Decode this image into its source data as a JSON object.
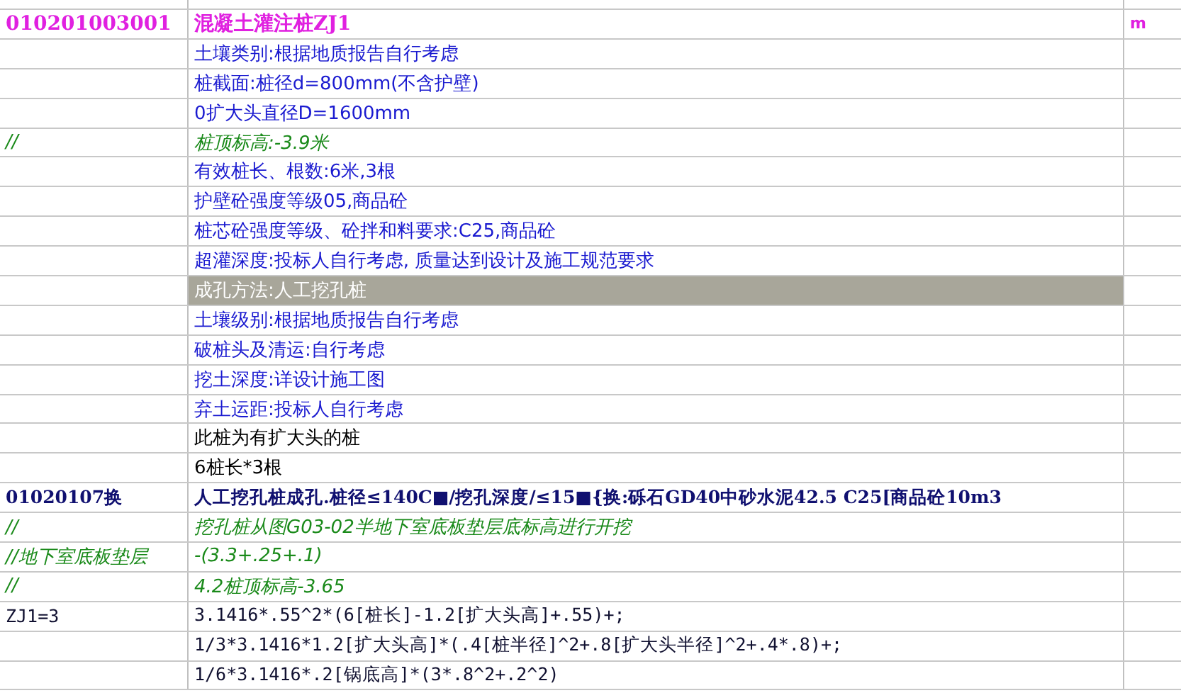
{
  "rows": [
    {
      "kind": "item",
      "code": "010201003001",
      "text": "混凝土灌注桩ZJ1",
      "unit": "m",
      "selected": false
    },
    {
      "kind": "feature",
      "text": "土壤类别:根据地质报告自行考虑",
      "selected": false
    },
    {
      "kind": "feature",
      "text": "桩截面:桩径d=800mm(不含护壁)",
      "selected": false
    },
    {
      "kind": "feature",
      "text": "0扩大头直径D=1600mm",
      "selected": false
    },
    {
      "kind": "comment",
      "code": "//",
      "text": "桩顶标高:-3.9米",
      "selected": false
    },
    {
      "kind": "feature",
      "text": "有效桩长、根数:6米,3根",
      "selected": false
    },
    {
      "kind": "feature",
      "text": "护壁砼强度等级05,商品砼",
      "selected": false
    },
    {
      "kind": "feature",
      "text": "桩芯砼强度等级、砼拌和料要求:C25,商品砼",
      "selected": false
    },
    {
      "kind": "feature",
      "text": "超灌深度:投标人自行考虑, 质量达到设计及施工规范要求",
      "selected": false
    },
    {
      "kind": "feature",
      "text": "成孔方法:人工挖孔桩",
      "selected": true
    },
    {
      "kind": "feature",
      "text": "土壤级别:根据地质报告自行考虑",
      "selected": false
    },
    {
      "kind": "feature",
      "text": "破桩头及清运:自行考虑",
      "selected": false
    },
    {
      "kind": "feature",
      "text": "挖土深度:详设计施工图",
      "selected": false
    },
    {
      "kind": "feature",
      "text": "弃土运距:投标人自行考虑",
      "selected": false
    },
    {
      "kind": "note",
      "text": "此桩为有扩大头的桩",
      "selected": false
    },
    {
      "kind": "note",
      "text": "6桩长*3根",
      "selected": false
    },
    {
      "kind": "sub",
      "code": "01020107换",
      "text": "人工挖孔桩成孔.桩径≤140C■/挖孔深度/≤15■{换:砾石GD40中砂水泥42.5 C25[商品砼10m3",
      "selected": false
    },
    {
      "kind": "comment",
      "code": "//",
      "text": "挖孔桩从图G03-02半地下室底板垫层底标高进行开挖",
      "selected": false
    },
    {
      "kind": "comment",
      "code": "//地下室底板垫层",
      "text": "-(3.3+.25+.1)",
      "selected": false
    },
    {
      "kind": "comment",
      "code": "//",
      "text": "4.2桩顶标高-3.65",
      "selected": false
    },
    {
      "kind": "calc",
      "code": "ZJ1=3",
      "text": "3.1416*.55^2*(6[桩长]-1.2[扩大头高]+.55)+;",
      "selected": false
    },
    {
      "kind": "calc",
      "text": "1/3*3.1416*1.2[扩大头高]*(.4[桩半径]^2+.8[扩大头半径]^2+.4*.8)+;",
      "selected": false
    },
    {
      "kind": "calc",
      "text": "1/6*3.1416*.2[锅底高]*(3*.8^2+.2^2)",
      "selected": false
    }
  ]
}
